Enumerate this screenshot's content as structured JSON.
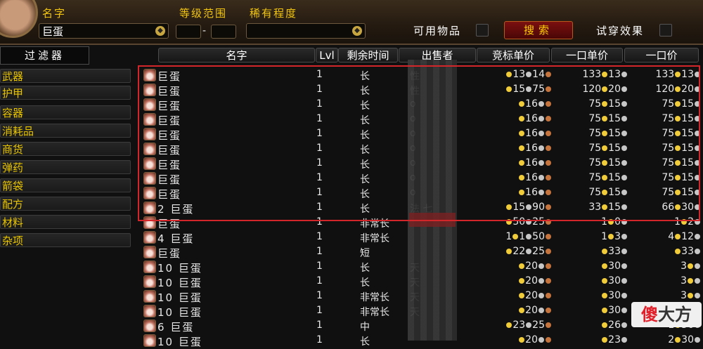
{
  "header": {
    "name_label": "名字",
    "name_value": "巨蛋",
    "level_range_label": "等级范围",
    "level_sep": "-",
    "rarity_label": "稀有程度",
    "usable_label": "可用物品",
    "search_button": "搜索",
    "try_on_label": "试穿效果"
  },
  "filters": {
    "title": "过滤器",
    "categories": [
      "武器",
      "护甲",
      "容器",
      "消耗品",
      "商货",
      "弹药",
      "箭袋",
      "配方",
      "材料",
      "杂项"
    ]
  },
  "columns": {
    "name": "名字",
    "lvl": "Lvl",
    "time": "剩余时间",
    "seller": "出售者",
    "bid": "竞标单价",
    "buyout_unit": "一口单价",
    "buyout": "一口价"
  },
  "rows": [
    {
      "qty": "",
      "name": "巨蛋",
      "lvl": "1",
      "time": "长",
      "seller": "性",
      "bid": {
        "g": "",
        "s": "13",
        "c": "14"
      },
      "unit": {
        "g": "133",
        "s": "13"
      },
      "total": {
        "g": "133",
        "s": "13"
      }
    },
    {
      "qty": "",
      "name": "巨蛋",
      "lvl": "1",
      "time": "长",
      "seller": "性",
      "bid": {
        "g": "",
        "s": "15",
        "c": "75"
      },
      "unit": {
        "g": "120",
        "s": "20"
      },
      "total": {
        "g": "120",
        "s": "20"
      }
    },
    {
      "qty": "",
      "name": "巨蛋",
      "lvl": "1",
      "time": "长",
      "seller": "o",
      "bid": {
        "g": "",
        "s": "16",
        "c": ""
      },
      "unit": {
        "g": "75",
        "s": "15"
      },
      "total": {
        "g": "75",
        "s": "15"
      }
    },
    {
      "qty": "",
      "name": "巨蛋",
      "lvl": "1",
      "time": "长",
      "seller": "o",
      "bid": {
        "g": "",
        "s": "16",
        "c": ""
      },
      "unit": {
        "g": "75",
        "s": "15"
      },
      "total": {
        "g": "75",
        "s": "15"
      }
    },
    {
      "qty": "",
      "name": "巨蛋",
      "lvl": "1",
      "time": "长",
      "seller": "o",
      "bid": {
        "g": "",
        "s": "16",
        "c": ""
      },
      "unit": {
        "g": "75",
        "s": "15"
      },
      "total": {
        "g": "75",
        "s": "15"
      }
    },
    {
      "qty": "",
      "name": "巨蛋",
      "lvl": "1",
      "time": "长",
      "seller": "o",
      "bid": {
        "g": "",
        "s": "16",
        "c": ""
      },
      "unit": {
        "g": "75",
        "s": "15"
      },
      "total": {
        "g": "75",
        "s": "15"
      }
    },
    {
      "qty": "",
      "name": "巨蛋",
      "lvl": "1",
      "time": "长",
      "seller": "o",
      "bid": {
        "g": "",
        "s": "16",
        "c": ""
      },
      "unit": {
        "g": "75",
        "s": "15"
      },
      "total": {
        "g": "75",
        "s": "15"
      }
    },
    {
      "qty": "",
      "name": "巨蛋",
      "lvl": "1",
      "time": "长",
      "seller": "o",
      "bid": {
        "g": "",
        "s": "16",
        "c": ""
      },
      "unit": {
        "g": "75",
        "s": "15"
      },
      "total": {
        "g": "75",
        "s": "15"
      }
    },
    {
      "qty": "",
      "name": "巨蛋",
      "lvl": "1",
      "time": "长",
      "seller": "o",
      "bid": {
        "g": "",
        "s": "16",
        "c": ""
      },
      "unit": {
        "g": "75",
        "s": "15"
      },
      "total": {
        "g": "75",
        "s": "15"
      }
    },
    {
      "qty": "2",
      "name": "巨蛋",
      "lvl": "1",
      "time": "长",
      "seller": "法 七",
      "bid": {
        "g": "",
        "s": "15",
        "c": "90"
      },
      "unit": {
        "g": "33",
        "s": "15"
      },
      "total": {
        "g": "66",
        "s": "30"
      }
    },
    {
      "qty": "",
      "name": "巨蛋",
      "lvl": "1",
      "time": "非常长",
      "seller": "",
      "bid": {
        "g": "",
        "s": "50",
        "c": "25"
      },
      "unit": {
        "g": "1",
        "s": "0"
      },
      "total": {
        "g": "1",
        "s": "2"
      }
    },
    {
      "qty": "4",
      "name": "巨蛋",
      "lvl": "1",
      "time": "非常长",
      "seller": "",
      "bid": {
        "g": "1",
        "s": "1",
        "c": "50"
      },
      "unit": {
        "g": "1",
        "s": "3"
      },
      "total": {
        "g": "4",
        "s": "12"
      }
    },
    {
      "qty": "",
      "name": "巨蛋",
      "lvl": "1",
      "time": "短",
      "seller": "",
      "bid": {
        "g": "",
        "s": "22",
        "c": "25"
      },
      "unit": {
        "g": "",
        "s": "33"
      },
      "total": {
        "g": "",
        "s": "33"
      }
    },
    {
      "qty": "10",
      "name": "巨蛋",
      "lvl": "1",
      "time": "长",
      "seller": "天",
      "bid": {
        "g": "",
        "s": "20",
        "c": ""
      },
      "unit": {
        "g": "",
        "s": "30"
      },
      "total": {
        "g": "3",
        "s": ""
      }
    },
    {
      "qty": "10",
      "name": "巨蛋",
      "lvl": "1",
      "time": "长",
      "seller": "天",
      "bid": {
        "g": "",
        "s": "20",
        "c": ""
      },
      "unit": {
        "g": "",
        "s": "30"
      },
      "total": {
        "g": "3",
        "s": ""
      }
    },
    {
      "qty": "10",
      "name": "巨蛋",
      "lvl": "1",
      "time": "非常长",
      "seller": "天",
      "bid": {
        "g": "",
        "s": "20",
        "c": ""
      },
      "unit": {
        "g": "",
        "s": "30"
      },
      "total": {
        "g": "3",
        "s": ""
      }
    },
    {
      "qty": "10",
      "name": "巨蛋",
      "lvl": "1",
      "time": "非常长",
      "seller": "天",
      "bid": {
        "g": "",
        "s": "20",
        "c": ""
      },
      "unit": {
        "g": "",
        "s": "30"
      },
      "total": {
        "g": "3",
        "s": ""
      }
    },
    {
      "qty": "6",
      "name": "巨蛋",
      "lvl": "1",
      "time": "中",
      "seller": "",
      "bid": {
        "g": "",
        "s": "23",
        "c": "25"
      },
      "unit": {
        "g": "",
        "s": "26"
      },
      "total": {
        "g": "1",
        "s": "56"
      }
    },
    {
      "qty": "10",
      "name": "巨蛋",
      "lvl": "1",
      "time": "长",
      "seller": "",
      "bid": {
        "g": "",
        "s": "20",
        "c": ""
      },
      "unit": {
        "g": "",
        "s": "23"
      },
      "total": {
        "g": "2",
        "s": "30"
      }
    }
  ],
  "watermark": {
    "a": "傻",
    "b": "大方"
  }
}
